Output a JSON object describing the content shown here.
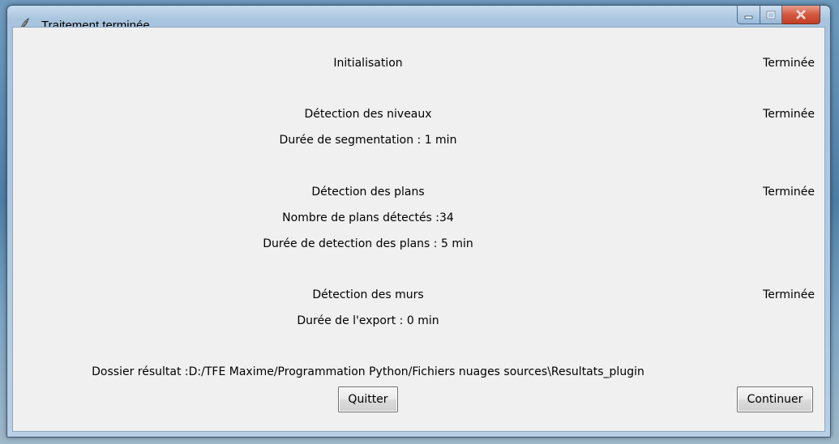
{
  "window": {
    "title": "Traitement terminée",
    "icon": "feather-icon"
  },
  "steps": [
    {
      "label": "Initialisation",
      "status": "Terminée"
    },
    {
      "label": "Détection des niveaux",
      "status": "Terminée",
      "details": [
        "Durée de segmentation : 1 min"
      ]
    },
    {
      "label": "Détection des plans",
      "status": "Terminée",
      "details": [
        "Nombre de plans détectés :34",
        "Durée de detection des plans : 5 min"
      ]
    },
    {
      "label": "Détection des murs",
      "status": "Terminée",
      "details": [
        "Durée de l'export : 0 min"
      ]
    }
  ],
  "result_folder": "Dossier résultat :D:/TFE Maxime/Programmation Python/Fichiers nuages sources\\Resultats_plugin",
  "buttons": {
    "quit": "Quitter",
    "continue": "Continuer"
  },
  "colors": {
    "close_button": "#c23f26",
    "window_bg": "#f0f0f0"
  }
}
